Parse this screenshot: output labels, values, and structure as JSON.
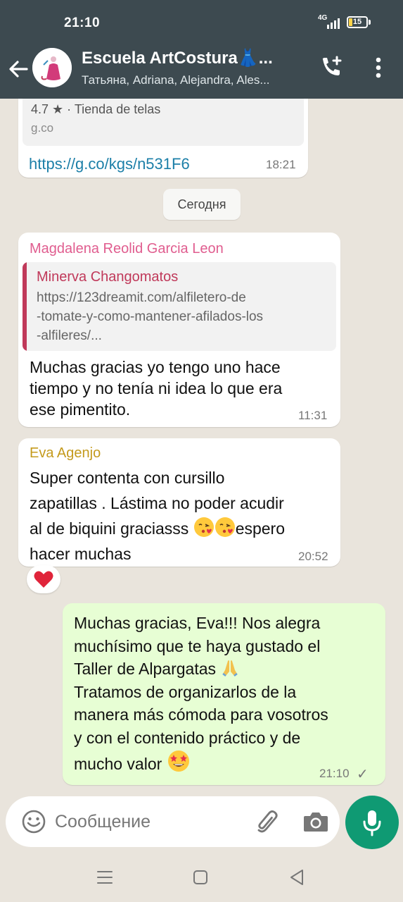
{
  "status_bar": {
    "time": "21:10",
    "network": "4G",
    "battery": "15"
  },
  "header": {
    "title": "Escuela ArtCostura👗...",
    "members": "Татьяна, Adriana, Alejandra, Ales..."
  },
  "messages": {
    "link_preview": {
      "rating": "4.7 ★ · Tienda de telas",
      "domain": "g.co",
      "url": "https://g.co/kgs/n531F6",
      "time": "18:21"
    },
    "date_divider": "Сегодня",
    "magdalena": {
      "sender": "Magdalena Reolid Garcia Leon",
      "quote_author": "Minerva Changomatos",
      "quote_lines": [
        "https://123dreamit.com/alfiletero-de",
        "-tomate-y-como-mantener-afilados-los",
        "-alfileres/..."
      ],
      "lines": [
        "Muchas gracias yo tengo uno hace",
        "tiempo y no tenía ni idea lo que era",
        "ese pimentito."
      ],
      "time": "11:31"
    },
    "eva": {
      "sender": "Eva Agenjo",
      "lines": [
        "Super contenta con cursillo",
        "zapatillas . Lástima no poder acudir",
        "al de biquini graciasss",
        "espero",
        "hacer muchas"
      ],
      "time": "20:52",
      "reaction": "heart"
    },
    "outgoing": {
      "lines": [
        "Muchas gracias, Eva!!! Nos alegra",
        "muchísimo que te haya gustado el",
        "Taller de Alpargatas",
        "Tratamos de organizarlos de la",
        "manera más cómoda para vosotros",
        "y con el contenido práctico y de",
        "mucho valor"
      ],
      "time": "21:10",
      "status": "✓"
    }
  },
  "composer": {
    "placeholder": "Сообщение"
  },
  "icons": [
    "back-arrow-icon",
    "add-call-icon",
    "more-vert-icon",
    "emoji-icon",
    "attach-icon",
    "camera-icon",
    "mic-icon",
    "heart-icon",
    "kiss-emoji-icon",
    "praying-hands-emoji-icon",
    "star-struck-emoji-icon"
  ],
  "colors": {
    "header": "#3d4a50",
    "chat_bg": "#e9e4dc",
    "outgoing_bubble": "#e7fed4",
    "accent_green": "#0f9a73",
    "magdalena_name": "#e05d8f",
    "eva_name": "#c49a1c",
    "quote_accent": "#c0395a",
    "link": "#1c7fa8"
  }
}
